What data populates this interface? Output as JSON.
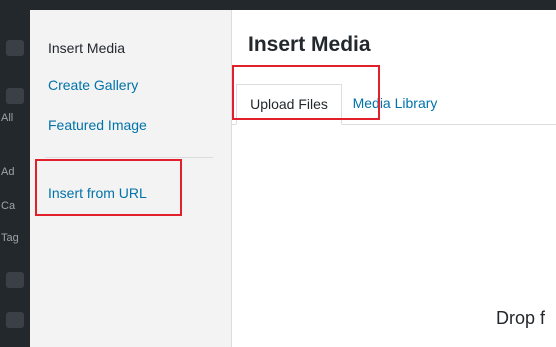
{
  "sidebar": {
    "items": [
      {
        "label": "Insert Media",
        "active": true
      },
      {
        "label": "Create Gallery",
        "active": false
      },
      {
        "label": "Featured Image",
        "active": false
      },
      {
        "label": "Insert from URL",
        "active": false
      }
    ]
  },
  "admin_menu": {
    "partial_labels": [
      "All",
      "Ad",
      "Ca",
      "Tag"
    ]
  },
  "content": {
    "title": "Insert Media",
    "tabs": [
      {
        "label": "Upload Files",
        "active": true
      },
      {
        "label": "Media Library",
        "active": false
      }
    ],
    "drop_text": "Drop f"
  },
  "colors": {
    "link": "#0073aa",
    "text": "#23282d",
    "sidebar_bg": "#f3f3f3",
    "admin_bar": "#23282d",
    "highlight": "#e0202a"
  }
}
